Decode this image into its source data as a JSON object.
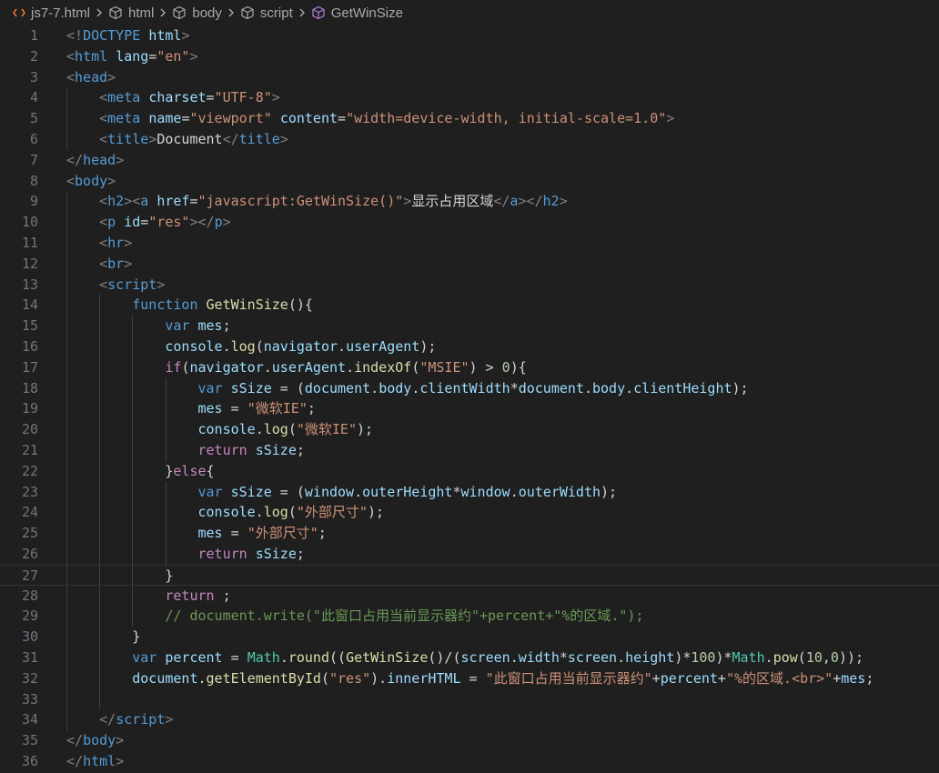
{
  "breadcrumb": {
    "file": "js7-7.html",
    "items": [
      "html",
      "body",
      "script",
      "GetWinSize"
    ]
  },
  "editor": {
    "lines": [
      {
        "n": "1",
        "tokens": [
          [
            "t",
            "<!"
          ],
          [
            "n",
            "DOCTYPE"
          ],
          [
            "p",
            " "
          ],
          [
            "a",
            "html"
          ],
          [
            "t",
            ">"
          ]
        ]
      },
      {
        "n": "2",
        "tokens": [
          [
            "t",
            "<"
          ],
          [
            "n",
            "html"
          ],
          [
            "p",
            " "
          ],
          [
            "a",
            "lang"
          ],
          [
            "p",
            "="
          ],
          [
            "s",
            "\"en\""
          ],
          [
            "t",
            ">"
          ]
        ]
      },
      {
        "n": "3",
        "tokens": [
          [
            "t",
            "<"
          ],
          [
            "n",
            "head"
          ],
          [
            "t",
            ">"
          ]
        ]
      },
      {
        "n": "4",
        "tokens": [
          [
            "p",
            "    "
          ],
          [
            "t",
            "<"
          ],
          [
            "n",
            "meta"
          ],
          [
            "p",
            " "
          ],
          [
            "a",
            "charset"
          ],
          [
            "p",
            "="
          ],
          [
            "s",
            "\"UTF-8\""
          ],
          [
            "t",
            ">"
          ]
        ]
      },
      {
        "n": "5",
        "tokens": [
          [
            "p",
            "    "
          ],
          [
            "t",
            "<"
          ],
          [
            "n",
            "meta"
          ],
          [
            "p",
            " "
          ],
          [
            "a",
            "name"
          ],
          [
            "p",
            "="
          ],
          [
            "s",
            "\"viewport\""
          ],
          [
            "p",
            " "
          ],
          [
            "a",
            "content"
          ],
          [
            "p",
            "="
          ],
          [
            "s",
            "\"width=device-width, initial-scale=1.0\""
          ],
          [
            "t",
            ">"
          ]
        ]
      },
      {
        "n": "6",
        "tokens": [
          [
            "p",
            "    "
          ],
          [
            "t",
            "<"
          ],
          [
            "n",
            "title"
          ],
          [
            "t",
            ">"
          ],
          [
            "p",
            "Document"
          ],
          [
            "t",
            "</"
          ],
          [
            "n",
            "title"
          ],
          [
            "t",
            ">"
          ]
        ]
      },
      {
        "n": "7",
        "tokens": [
          [
            "t",
            "</"
          ],
          [
            "n",
            "head"
          ],
          [
            "t",
            ">"
          ]
        ]
      },
      {
        "n": "8",
        "tokens": [
          [
            "t",
            "<"
          ],
          [
            "n",
            "body"
          ],
          [
            "t",
            ">"
          ]
        ]
      },
      {
        "n": "9",
        "tokens": [
          [
            "p",
            "    "
          ],
          [
            "t",
            "<"
          ],
          [
            "n",
            "h2"
          ],
          [
            "t",
            "><"
          ],
          [
            "n",
            "a"
          ],
          [
            "p",
            " "
          ],
          [
            "a",
            "href"
          ],
          [
            "p",
            "="
          ],
          [
            "s",
            "\"javascript:GetWinSize()\""
          ],
          [
            "t",
            ">"
          ],
          [
            "p",
            "显示占用区域"
          ],
          [
            "t",
            "</"
          ],
          [
            "n",
            "a"
          ],
          [
            "t",
            "></"
          ],
          [
            "n",
            "h2"
          ],
          [
            "t",
            ">"
          ]
        ]
      },
      {
        "n": "10",
        "tokens": [
          [
            "p",
            "    "
          ],
          [
            "t",
            "<"
          ],
          [
            "n",
            "p"
          ],
          [
            "p",
            " "
          ],
          [
            "a",
            "id"
          ],
          [
            "p",
            "="
          ],
          [
            "s",
            "\"res\""
          ],
          [
            "t",
            "></"
          ],
          [
            "n",
            "p"
          ],
          [
            "t",
            ">"
          ]
        ]
      },
      {
        "n": "11",
        "tokens": [
          [
            "p",
            "    "
          ],
          [
            "t",
            "<"
          ],
          [
            "n",
            "hr"
          ],
          [
            "t",
            ">"
          ]
        ]
      },
      {
        "n": "12",
        "tokens": [
          [
            "p",
            "    "
          ],
          [
            "t",
            "<"
          ],
          [
            "n",
            "br"
          ],
          [
            "t",
            ">"
          ]
        ]
      },
      {
        "n": "13",
        "tokens": [
          [
            "p",
            "    "
          ],
          [
            "t",
            "<"
          ],
          [
            "n",
            "script"
          ],
          [
            "t",
            ">"
          ]
        ]
      },
      {
        "n": "14",
        "tokens": [
          [
            "p",
            "        "
          ],
          [
            "n",
            "function"
          ],
          [
            "p",
            " "
          ],
          [
            "f",
            "GetWinSize"
          ],
          [
            "p",
            "(){"
          ]
        ]
      },
      {
        "n": "15",
        "tokens": [
          [
            "p",
            "            "
          ],
          [
            "n",
            "var"
          ],
          [
            "p",
            " "
          ],
          [
            "a",
            "mes"
          ],
          [
            "p",
            ";"
          ]
        ]
      },
      {
        "n": "16",
        "tokens": [
          [
            "p",
            "            "
          ],
          [
            "a",
            "console"
          ],
          [
            "p",
            "."
          ],
          [
            "f",
            "log"
          ],
          [
            "p",
            "("
          ],
          [
            "a",
            "navigator"
          ],
          [
            "p",
            "."
          ],
          [
            "a",
            "userAgent"
          ],
          [
            "p",
            ");"
          ]
        ]
      },
      {
        "n": "17",
        "tokens": [
          [
            "p",
            "            "
          ],
          [
            "k",
            "if"
          ],
          [
            "p",
            "("
          ],
          [
            "a",
            "navigator"
          ],
          [
            "p",
            "."
          ],
          [
            "a",
            "userAgent"
          ],
          [
            "p",
            "."
          ],
          [
            "f",
            "indexOf"
          ],
          [
            "p",
            "("
          ],
          [
            "s",
            "\"MSIE\""
          ],
          [
            "p",
            ") > "
          ],
          [
            "nm",
            "0"
          ],
          [
            "p",
            "){"
          ]
        ]
      },
      {
        "n": "18",
        "tokens": [
          [
            "p",
            "                "
          ],
          [
            "n",
            "var"
          ],
          [
            "p",
            " "
          ],
          [
            "a",
            "sSize"
          ],
          [
            "p",
            " = ("
          ],
          [
            "a",
            "document"
          ],
          [
            "p",
            "."
          ],
          [
            "a",
            "body"
          ],
          [
            "p",
            "."
          ],
          [
            "a",
            "clientWidth"
          ],
          [
            "p",
            "*"
          ],
          [
            "a",
            "document"
          ],
          [
            "p",
            "."
          ],
          [
            "a",
            "body"
          ],
          [
            "p",
            "."
          ],
          [
            "a",
            "clientHeight"
          ],
          [
            "p",
            ");"
          ]
        ]
      },
      {
        "n": "19",
        "tokens": [
          [
            "p",
            "                "
          ],
          [
            "a",
            "mes"
          ],
          [
            "p",
            " = "
          ],
          [
            "s",
            "\"微软IE\""
          ],
          [
            "p",
            ";"
          ]
        ]
      },
      {
        "n": "20",
        "tokens": [
          [
            "p",
            "                "
          ],
          [
            "a",
            "console"
          ],
          [
            "p",
            "."
          ],
          [
            "f",
            "log"
          ],
          [
            "p",
            "("
          ],
          [
            "s",
            "\"微软IE\""
          ],
          [
            "p",
            ");"
          ]
        ]
      },
      {
        "n": "21",
        "tokens": [
          [
            "p",
            "                "
          ],
          [
            "k",
            "return"
          ],
          [
            "p",
            " "
          ],
          [
            "a",
            "sSize"
          ],
          [
            "p",
            ";"
          ]
        ]
      },
      {
        "n": "22",
        "tokens": [
          [
            "p",
            "            "
          ],
          [
            "p",
            "}"
          ],
          [
            "k",
            "else"
          ],
          [
            "p",
            "{"
          ]
        ]
      },
      {
        "n": "23",
        "tokens": [
          [
            "p",
            "                "
          ],
          [
            "n",
            "var"
          ],
          [
            "p",
            " "
          ],
          [
            "a",
            "sSize"
          ],
          [
            "p",
            " = ("
          ],
          [
            "a",
            "window"
          ],
          [
            "p",
            "."
          ],
          [
            "a",
            "outerHeight"
          ],
          [
            "p",
            "*"
          ],
          [
            "a",
            "window"
          ],
          [
            "p",
            "."
          ],
          [
            "a",
            "outerWidth"
          ],
          [
            "p",
            ");"
          ]
        ]
      },
      {
        "n": "24",
        "tokens": [
          [
            "p",
            "                "
          ],
          [
            "a",
            "console"
          ],
          [
            "p",
            "."
          ],
          [
            "f",
            "log"
          ],
          [
            "p",
            "("
          ],
          [
            "s",
            "\"外部尺寸\""
          ],
          [
            "p",
            ");"
          ]
        ]
      },
      {
        "n": "25",
        "tokens": [
          [
            "p",
            "                "
          ],
          [
            "a",
            "mes"
          ],
          [
            "p",
            " = "
          ],
          [
            "s",
            "\"外部尺寸\""
          ],
          [
            "p",
            ";"
          ]
        ]
      },
      {
        "n": "26",
        "tokens": [
          [
            "p",
            "                "
          ],
          [
            "k",
            "return"
          ],
          [
            "p",
            " "
          ],
          [
            "a",
            "sSize"
          ],
          [
            "p",
            ";"
          ]
        ]
      },
      {
        "n": "27",
        "tokens": [
          [
            "p",
            "            "
          ],
          [
            "p",
            "}"
          ]
        ]
      },
      {
        "n": "28",
        "tokens": [
          [
            "p",
            "            "
          ],
          [
            "k",
            "return"
          ],
          [
            "p",
            " ;"
          ]
        ]
      },
      {
        "n": "29",
        "tokens": [
          [
            "p",
            "            "
          ],
          [
            "c",
            "// document.write(\"此窗口占用当前显示器约\"+percent+\"%的区域.\");"
          ]
        ]
      },
      {
        "n": "30",
        "tokens": [
          [
            "p",
            "        "
          ],
          [
            "p",
            "}"
          ]
        ]
      },
      {
        "n": "31",
        "tokens": [
          [
            "p",
            "        "
          ],
          [
            "n",
            "var"
          ],
          [
            "p",
            " "
          ],
          [
            "a",
            "percent"
          ],
          [
            "p",
            " = "
          ],
          [
            "cl",
            "Math"
          ],
          [
            "p",
            "."
          ],
          [
            "f",
            "round"
          ],
          [
            "p",
            "(("
          ],
          [
            "f",
            "GetWinSize"
          ],
          [
            "p",
            "()/("
          ],
          [
            "a",
            "screen"
          ],
          [
            "p",
            "."
          ],
          [
            "a",
            "width"
          ],
          [
            "p",
            "*"
          ],
          [
            "a",
            "screen"
          ],
          [
            "p",
            "."
          ],
          [
            "a",
            "height"
          ],
          [
            "p",
            ")*"
          ],
          [
            "nm",
            "100"
          ],
          [
            "p",
            ")*"
          ],
          [
            "cl",
            "Math"
          ],
          [
            "p",
            "."
          ],
          [
            "f",
            "pow"
          ],
          [
            "p",
            "("
          ],
          [
            "nm",
            "10"
          ],
          [
            "p",
            ","
          ],
          [
            "nm",
            "0"
          ],
          [
            "p",
            "));"
          ]
        ]
      },
      {
        "n": "32",
        "tokens": [
          [
            "p",
            "        "
          ],
          [
            "a",
            "document"
          ],
          [
            "p",
            "."
          ],
          [
            "f",
            "getElementById"
          ],
          [
            "p",
            "("
          ],
          [
            "s",
            "\"res\""
          ],
          [
            "p",
            ")."
          ],
          [
            "a",
            "innerHTML"
          ],
          [
            "p",
            " = "
          ],
          [
            "s",
            "\"此窗口占用当前显示器约\""
          ],
          [
            "p",
            "+"
          ],
          [
            "a",
            "percent"
          ],
          [
            "p",
            "+"
          ],
          [
            "s",
            "\"%的区域.<br>\""
          ],
          [
            "p",
            "+"
          ],
          [
            "a",
            "mes"
          ],
          [
            "p",
            ";"
          ]
        ]
      },
      {
        "n": "33",
        "tokens": []
      },
      {
        "n": "34",
        "tokens": [
          [
            "p",
            "    "
          ],
          [
            "t",
            "</"
          ],
          [
            "n",
            "script"
          ],
          [
            "t",
            ">"
          ]
        ]
      },
      {
        "n": "35",
        "tokens": [
          [
            "t",
            "</"
          ],
          [
            "n",
            "body"
          ],
          [
            "t",
            ">"
          ]
        ]
      },
      {
        "n": "36",
        "tokens": [
          [
            "t",
            "</"
          ],
          [
            "n",
            "html"
          ],
          [
            "t",
            ">"
          ]
        ]
      }
    ]
  }
}
